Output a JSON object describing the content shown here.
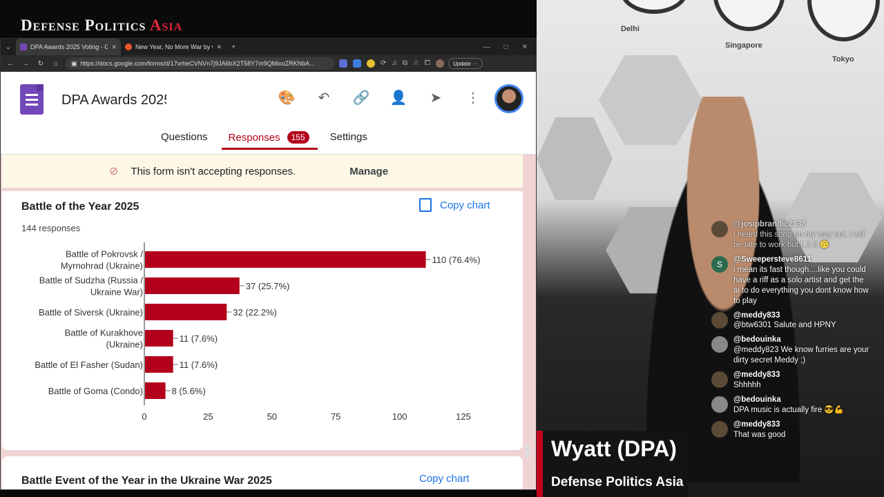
{
  "brand": {
    "main": "Defense Politics",
    "accent": "Asia"
  },
  "browser": {
    "tabs": [
      {
        "title": "DPA Awards 2025 Voting - Google Forms",
        "active": true
      },
      {
        "title": "New Year, No More War by wyatt",
        "active": false
      }
    ],
    "url": "https://docs.google.com/forms/d/17vrheCVNVn7j9JA6bX2T58Y7m9QMixoZRKNbA...",
    "update_label": "Update"
  },
  "form": {
    "title": "DPA Awards 2025",
    "tabs": {
      "questions": "Questions",
      "responses": "Responses",
      "responses_count": "155",
      "settings": "Settings"
    },
    "notice": {
      "text": "This form isn't accepting responses.",
      "action": "Manage"
    },
    "question": {
      "title": "Battle of the Year 2025",
      "count": "144 responses",
      "copy_label": "Copy chart"
    },
    "next_question": {
      "title": "Battle Event of the Year in the Ukraine War 2025",
      "copy_label": "Copy chart"
    }
  },
  "chart_data": {
    "type": "bar",
    "orientation": "horizontal",
    "categories": [
      [
        "Battle of Pokrovsk /",
        "Myrnohrad (Ukraine)"
      ],
      [
        "Battle of Sudzha (Russia /",
        "Ukraine War)"
      ],
      [
        "Battle of Siversk (Ukraine)"
      ],
      [
        "Battle of Kurakhove",
        "(Ukraine)"
      ],
      [
        "Battle of El Fasher (Sudan)"
      ],
      [
        "Battle of Goma (Condo)"
      ]
    ],
    "values": [
      110,
      37,
      32,
      11,
      11,
      8
    ],
    "data_labels": [
      "110 (76.4%)",
      "37 (25.7%)",
      "32 (22.2%)",
      "11 (7.6%)",
      "11 (7.6%)",
      "8 (5.6%)"
    ],
    "xlim": [
      0,
      125
    ],
    "ticks": [
      0,
      25,
      50,
      75,
      100,
      125
    ],
    "color": "#b3001b"
  },
  "chat": [
    {
      "user": "@josipbrandic2138",
      "text": "i heard this song on my way out, i will be late to work but f..k it 🙃",
      "avatar": "a"
    },
    {
      "user": "@Sweepersteve8611",
      "text": "i mean its fast though....like you could have a riff as a solo artist and get the ai to do everything you dont know how to play",
      "avatar": "S"
    },
    {
      "user": "@meddy833",
      "text": "@btw6301 Salute and HPNY",
      "avatar": "a"
    },
    {
      "user": "@bedouinka",
      "text": "@meddy823 We know furries are your dirty secret Meddy ;)",
      "avatar": "b"
    },
    {
      "user": "@meddy833",
      "text": "Shhhhh",
      "avatar": "a"
    },
    {
      "user": "@bedouinka",
      "text": "DPA music is actually fire 😎💪",
      "avatar": "b"
    },
    {
      "user": "@meddy833",
      "text": "That was good",
      "avatar": "a"
    }
  ],
  "clocks": [
    "Delhi",
    "Singapore",
    "Tokyo"
  ],
  "nameplate": {
    "name": "Wyatt (DPA)",
    "channel": "Defense Politics Asia"
  }
}
